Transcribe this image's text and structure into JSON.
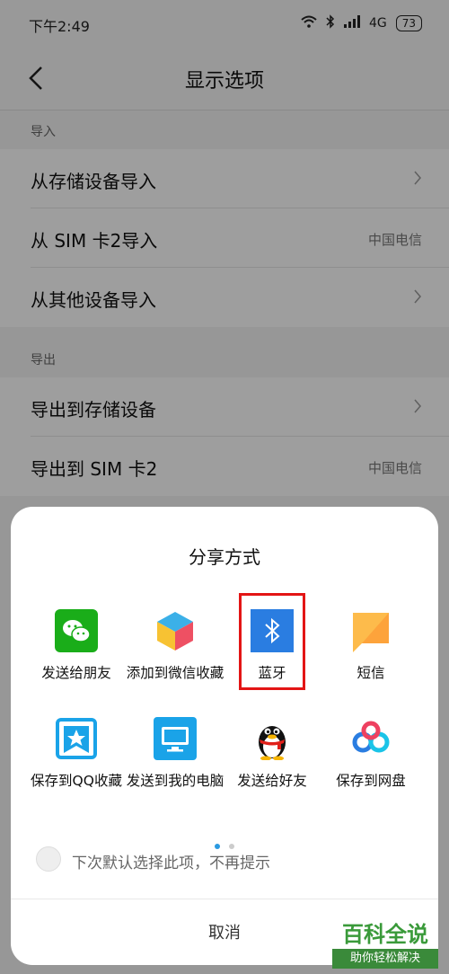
{
  "status_bar": {
    "time": "下午2:49",
    "network": "4G",
    "battery": "73"
  },
  "header": {
    "title": "显示选项"
  },
  "import_section": {
    "label": "导入",
    "items": [
      {
        "label": "从存储设备导入",
        "value": ""
      },
      {
        "label": "从 SIM 卡2导入",
        "value": "中国电信"
      },
      {
        "label": "从其他设备导入",
        "value": ""
      }
    ]
  },
  "export_section": {
    "label": "导出",
    "items": [
      {
        "label": "导出到存储设备",
        "value": ""
      },
      {
        "label": "导出到 SIM 卡2",
        "value": "中国电信"
      }
    ]
  },
  "share_sheet": {
    "title": "分享方式",
    "items": [
      {
        "label": "发送给朋友",
        "icon": "wechat-icon"
      },
      {
        "label": "添加到微信收藏",
        "icon": "wechat-favorites-icon"
      },
      {
        "label": "蓝牙",
        "icon": "bluetooth-icon"
      },
      {
        "label": "短信",
        "icon": "sms-icon"
      },
      {
        "label": "保存到QQ收藏",
        "icon": "qq-favorites-icon"
      },
      {
        "label": "发送到我的电脑",
        "icon": "computer-icon"
      },
      {
        "label": "发送给好友",
        "icon": "qq-penguin-icon"
      },
      {
        "label": "保存到网盘",
        "icon": "cloud-drive-icon"
      }
    ],
    "default_option_label": "下次默认选择此项，不再提示",
    "cancel_label": "取消",
    "page_count": 2,
    "current_page": 1
  },
  "watermark": {
    "title": "百科全说",
    "subtitle": "助你轻松解决"
  },
  "colors": {
    "wechat": "#1aad19",
    "bluetooth": "#2a7de1",
    "highlight": "#e31515",
    "page_dot_active": "#2a9ae1"
  }
}
